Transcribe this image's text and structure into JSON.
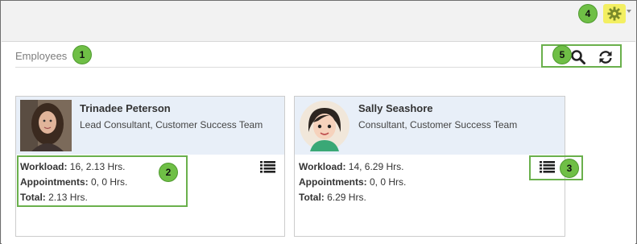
{
  "panel": {
    "title": "Employees"
  },
  "toolbar": {
    "search_icon": "search-icon",
    "refresh_icon": "refresh-icon"
  },
  "settings": {
    "icon": "gear-icon"
  },
  "labels": {
    "workload": "Workload:",
    "appointments": "Appointments:",
    "total": "Total:"
  },
  "employees": [
    {
      "name": "Trinadee Peterson",
      "role": "Lead Consultant, Customer Success Team",
      "workload": " 16, 2.13 Hrs.",
      "appointments": " 0, 0 Hrs.",
      "total": " 2.13 Hrs."
    },
    {
      "name": "Sally Seashore",
      "role": "Consultant, Customer Success Team",
      "workload": " 14, 6.29 Hrs.",
      "appointments": " 0, 0 Hrs.",
      "total": " 6.29 Hrs."
    }
  ],
  "callouts": [
    "1",
    "2",
    "3",
    "4",
    "5"
  ],
  "colors": {
    "highlight": "#6ab04c",
    "gear_bg": "#f3ef62",
    "header_bg": "#e8eff8"
  }
}
